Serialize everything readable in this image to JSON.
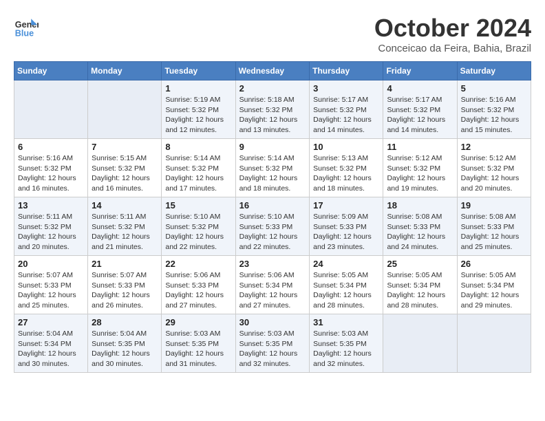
{
  "header": {
    "logo_line1": "General",
    "logo_line2": "Blue",
    "month": "October 2024",
    "location": "Conceicao da Feira, Bahia, Brazil"
  },
  "weekdays": [
    "Sunday",
    "Monday",
    "Tuesday",
    "Wednesday",
    "Thursday",
    "Friday",
    "Saturday"
  ],
  "weeks": [
    [
      {
        "day": "",
        "info": ""
      },
      {
        "day": "",
        "info": ""
      },
      {
        "day": "1",
        "info": "Sunrise: 5:19 AM\nSunset: 5:32 PM\nDaylight: 12 hours and 12 minutes."
      },
      {
        "day": "2",
        "info": "Sunrise: 5:18 AM\nSunset: 5:32 PM\nDaylight: 12 hours and 13 minutes."
      },
      {
        "day": "3",
        "info": "Sunrise: 5:17 AM\nSunset: 5:32 PM\nDaylight: 12 hours and 14 minutes."
      },
      {
        "day": "4",
        "info": "Sunrise: 5:17 AM\nSunset: 5:32 PM\nDaylight: 12 hours and 14 minutes."
      },
      {
        "day": "5",
        "info": "Sunrise: 5:16 AM\nSunset: 5:32 PM\nDaylight: 12 hours and 15 minutes."
      }
    ],
    [
      {
        "day": "6",
        "info": "Sunrise: 5:16 AM\nSunset: 5:32 PM\nDaylight: 12 hours and 16 minutes."
      },
      {
        "day": "7",
        "info": "Sunrise: 5:15 AM\nSunset: 5:32 PM\nDaylight: 12 hours and 16 minutes."
      },
      {
        "day": "8",
        "info": "Sunrise: 5:14 AM\nSunset: 5:32 PM\nDaylight: 12 hours and 17 minutes."
      },
      {
        "day": "9",
        "info": "Sunrise: 5:14 AM\nSunset: 5:32 PM\nDaylight: 12 hours and 18 minutes."
      },
      {
        "day": "10",
        "info": "Sunrise: 5:13 AM\nSunset: 5:32 PM\nDaylight: 12 hours and 18 minutes."
      },
      {
        "day": "11",
        "info": "Sunrise: 5:12 AM\nSunset: 5:32 PM\nDaylight: 12 hours and 19 minutes."
      },
      {
        "day": "12",
        "info": "Sunrise: 5:12 AM\nSunset: 5:32 PM\nDaylight: 12 hours and 20 minutes."
      }
    ],
    [
      {
        "day": "13",
        "info": "Sunrise: 5:11 AM\nSunset: 5:32 PM\nDaylight: 12 hours and 20 minutes."
      },
      {
        "day": "14",
        "info": "Sunrise: 5:11 AM\nSunset: 5:32 PM\nDaylight: 12 hours and 21 minutes."
      },
      {
        "day": "15",
        "info": "Sunrise: 5:10 AM\nSunset: 5:32 PM\nDaylight: 12 hours and 22 minutes."
      },
      {
        "day": "16",
        "info": "Sunrise: 5:10 AM\nSunset: 5:33 PM\nDaylight: 12 hours and 22 minutes."
      },
      {
        "day": "17",
        "info": "Sunrise: 5:09 AM\nSunset: 5:33 PM\nDaylight: 12 hours and 23 minutes."
      },
      {
        "day": "18",
        "info": "Sunrise: 5:08 AM\nSunset: 5:33 PM\nDaylight: 12 hours and 24 minutes."
      },
      {
        "day": "19",
        "info": "Sunrise: 5:08 AM\nSunset: 5:33 PM\nDaylight: 12 hours and 25 minutes."
      }
    ],
    [
      {
        "day": "20",
        "info": "Sunrise: 5:07 AM\nSunset: 5:33 PM\nDaylight: 12 hours and 25 minutes."
      },
      {
        "day": "21",
        "info": "Sunrise: 5:07 AM\nSunset: 5:33 PM\nDaylight: 12 hours and 26 minutes."
      },
      {
        "day": "22",
        "info": "Sunrise: 5:06 AM\nSunset: 5:33 PM\nDaylight: 12 hours and 27 minutes."
      },
      {
        "day": "23",
        "info": "Sunrise: 5:06 AM\nSunset: 5:34 PM\nDaylight: 12 hours and 27 minutes."
      },
      {
        "day": "24",
        "info": "Sunrise: 5:05 AM\nSunset: 5:34 PM\nDaylight: 12 hours and 28 minutes."
      },
      {
        "day": "25",
        "info": "Sunrise: 5:05 AM\nSunset: 5:34 PM\nDaylight: 12 hours and 28 minutes."
      },
      {
        "day": "26",
        "info": "Sunrise: 5:05 AM\nSunset: 5:34 PM\nDaylight: 12 hours and 29 minutes."
      }
    ],
    [
      {
        "day": "27",
        "info": "Sunrise: 5:04 AM\nSunset: 5:34 PM\nDaylight: 12 hours and 30 minutes."
      },
      {
        "day": "28",
        "info": "Sunrise: 5:04 AM\nSunset: 5:35 PM\nDaylight: 12 hours and 30 minutes."
      },
      {
        "day": "29",
        "info": "Sunrise: 5:03 AM\nSunset: 5:35 PM\nDaylight: 12 hours and 31 minutes."
      },
      {
        "day": "30",
        "info": "Sunrise: 5:03 AM\nSunset: 5:35 PM\nDaylight: 12 hours and 32 minutes."
      },
      {
        "day": "31",
        "info": "Sunrise: 5:03 AM\nSunset: 5:35 PM\nDaylight: 12 hours and 32 minutes."
      },
      {
        "day": "",
        "info": ""
      },
      {
        "day": "",
        "info": ""
      }
    ]
  ]
}
